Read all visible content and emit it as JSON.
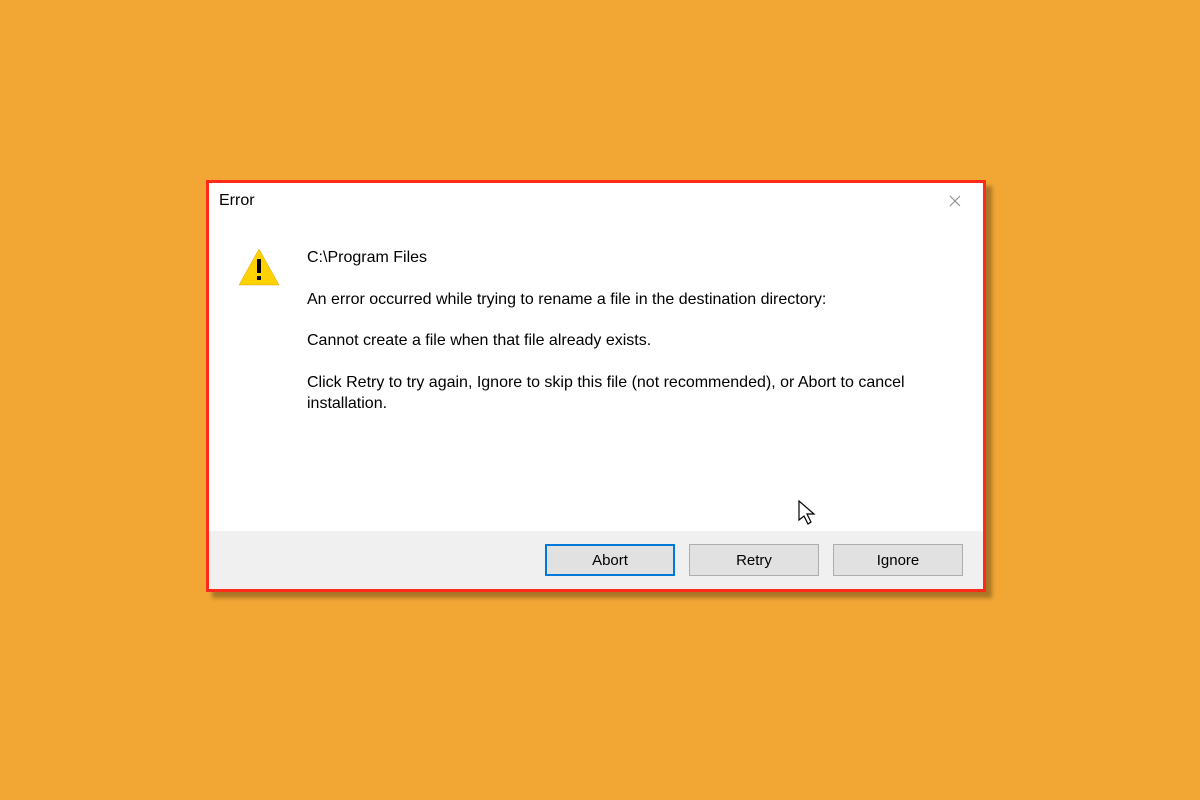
{
  "dialog": {
    "title": "Error",
    "path": "C:\\Program Files",
    "message1": "An error occurred while trying to rename a file in the destination directory:",
    "message2": "Cannot create a file when that file already exists.",
    "message3": "Click Retry to try again, Ignore to skip this file (not recommended), or Abort to cancel installation.",
    "buttons": {
      "abort": "Abort",
      "retry": "Retry",
      "ignore": "Ignore"
    }
  }
}
